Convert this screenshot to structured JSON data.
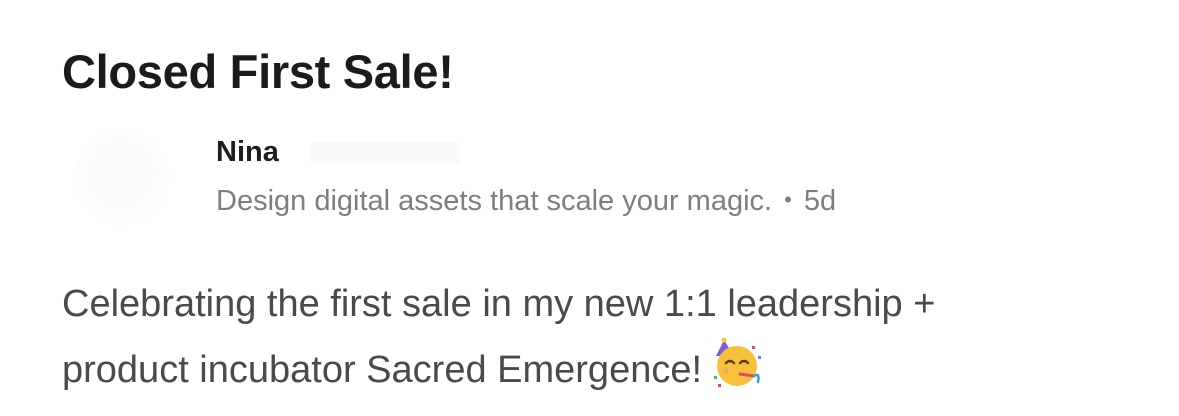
{
  "post": {
    "title": "Closed First Sale!",
    "author": {
      "name": "Nina",
      "tagline": "Design digital assets that scale your magic.",
      "separator": "•",
      "age": "5d"
    },
    "body": {
      "line1": "Celebrating the first sale in my new 1:1 leadership +",
      "line2": "product incubator Sacred Emergence!",
      "emoji": "partying-face-icon"
    }
  }
}
